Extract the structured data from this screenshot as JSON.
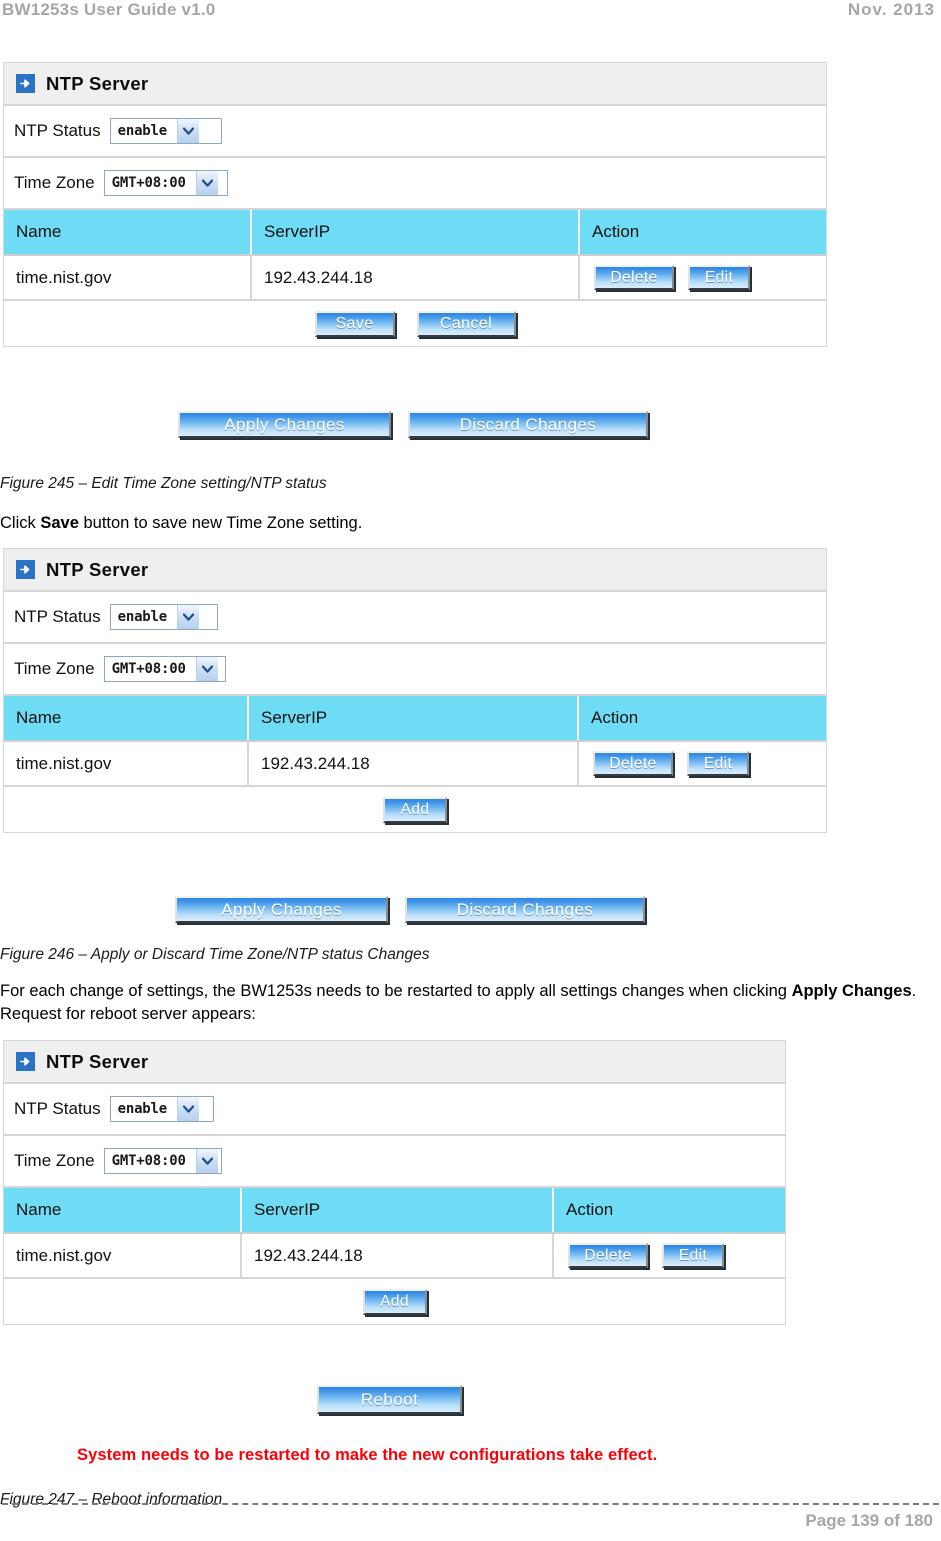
{
  "page_header": {
    "left": "BW1253s User Guide v1.0",
    "right": "Nov.  2013"
  },
  "page_footer": {
    "page_number": "Page 139 of 180"
  },
  "colors": {
    "table_header_bg": "#6fdcf5",
    "panel_title_bg": "#efefef",
    "button_blue": "#2f86e0",
    "warning_red": "#fb0007",
    "header_gray": "#a6a6a6"
  },
  "panels": [
    {
      "id": "panel-edit",
      "title": "NTP Server",
      "title_icon": "arrow-right-icon",
      "fields": [
        {
          "label": "NTP Status",
          "value": "enable",
          "icon": "chevron-down-icon"
        },
        {
          "label": "Time Zone",
          "value": "GMT+08:00",
          "icon": "chevron-down-icon"
        }
      ],
      "table": {
        "headers": [
          "Name",
          "ServerIP",
          "Action"
        ],
        "rows": [
          {
            "name": "time.nist.gov",
            "serverip": "192.43.244.18",
            "actions": [
              "Delete",
              "Edit"
            ]
          }
        ]
      },
      "footer_buttons": [
        "Save",
        "Cancel"
      ]
    },
    {
      "id": "panel-saved",
      "title": "NTP Server",
      "title_icon": "arrow-right-icon",
      "fields": [
        {
          "label": "NTP Status",
          "value": "enable",
          "icon": "chevron-down-icon"
        },
        {
          "label": "Time Zone",
          "value": "GMT+08:00",
          "icon": "chevron-down-icon"
        }
      ],
      "table": {
        "headers": [
          "Name",
          "ServerIP",
          "Action"
        ],
        "rows": [
          {
            "name": "time.nist.gov",
            "serverip": "192.43.244.18",
            "actions": [
              "Delete",
              "Edit"
            ]
          }
        ]
      },
      "footer_buttons": [
        "Add"
      ]
    },
    {
      "id": "panel-reboot",
      "title": "NTP Server",
      "title_icon": "arrow-right-icon",
      "fields": [
        {
          "label": "NTP Status",
          "value": "enable",
          "icon": "chevron-down-icon"
        },
        {
          "label": "Time Zone",
          "value": "GMT+08:00",
          "icon": "chevron-down-icon"
        }
      ],
      "table": {
        "headers": [
          "Name",
          "ServerIP",
          "Action"
        ],
        "rows": [
          {
            "name": "time.nist.gov",
            "serverip": "192.43.244.18",
            "actions": [
              "Delete",
              "Edit"
            ]
          }
        ]
      },
      "footer_buttons": [
        "Add"
      ]
    }
  ],
  "action_bars": {
    "bar1": {
      "apply": "Apply Changes",
      "discard": "Discard Changes"
    },
    "bar2": {
      "apply": "Apply Changes",
      "discard": "Discard Changes"
    },
    "bar3": {
      "reboot": "Reboot"
    }
  },
  "warning": {
    "text": "System needs to be restarted to make the new configurations take effect."
  },
  "captions": {
    "fig245": "Figure 245 – Edit Time Zone setting/NTP status",
    "fig246": "Figure 246 – Apply or Discard Time Zone/NTP status Changes",
    "fig247": "Figure 247 – Reboot information"
  },
  "paragraphs": {
    "p1_pre": "Click ",
    "p1_bold": "Save",
    "p1_post": " button to save new Time Zone setting.",
    "p2_pre": "For each change of settings, the BW1253s needs to be restarted to apply all settings changes when clicking ",
    "p2_bold": "Apply Changes",
    "p2_post": ". Request for reboot server appears:"
  }
}
